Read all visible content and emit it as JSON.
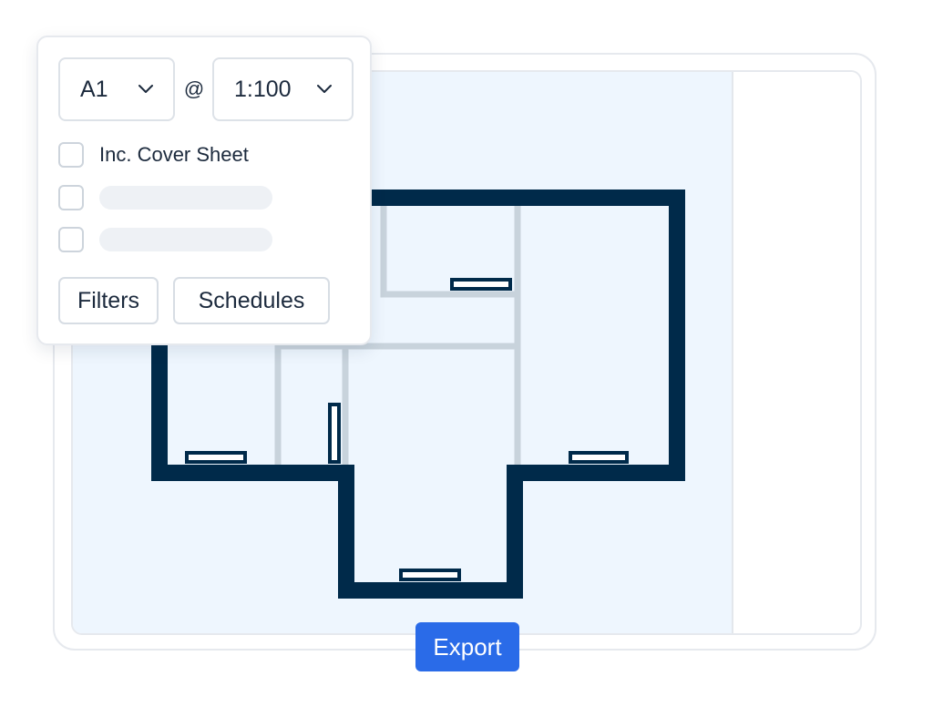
{
  "print_settings": {
    "paper_size": "A1",
    "separator": "@",
    "scale": "1:100",
    "options": [
      {
        "label": "Inc. Cover Sheet",
        "checked": false
      }
    ],
    "filters_label": "Filters",
    "schedules_label": "Schedules"
  },
  "actions": {
    "export_label": "Export"
  },
  "colors": {
    "wall": "#002a4a",
    "partition": "#c8d3dc",
    "canvas_bg": "#eef6fe",
    "accent": "#2a6be8"
  }
}
